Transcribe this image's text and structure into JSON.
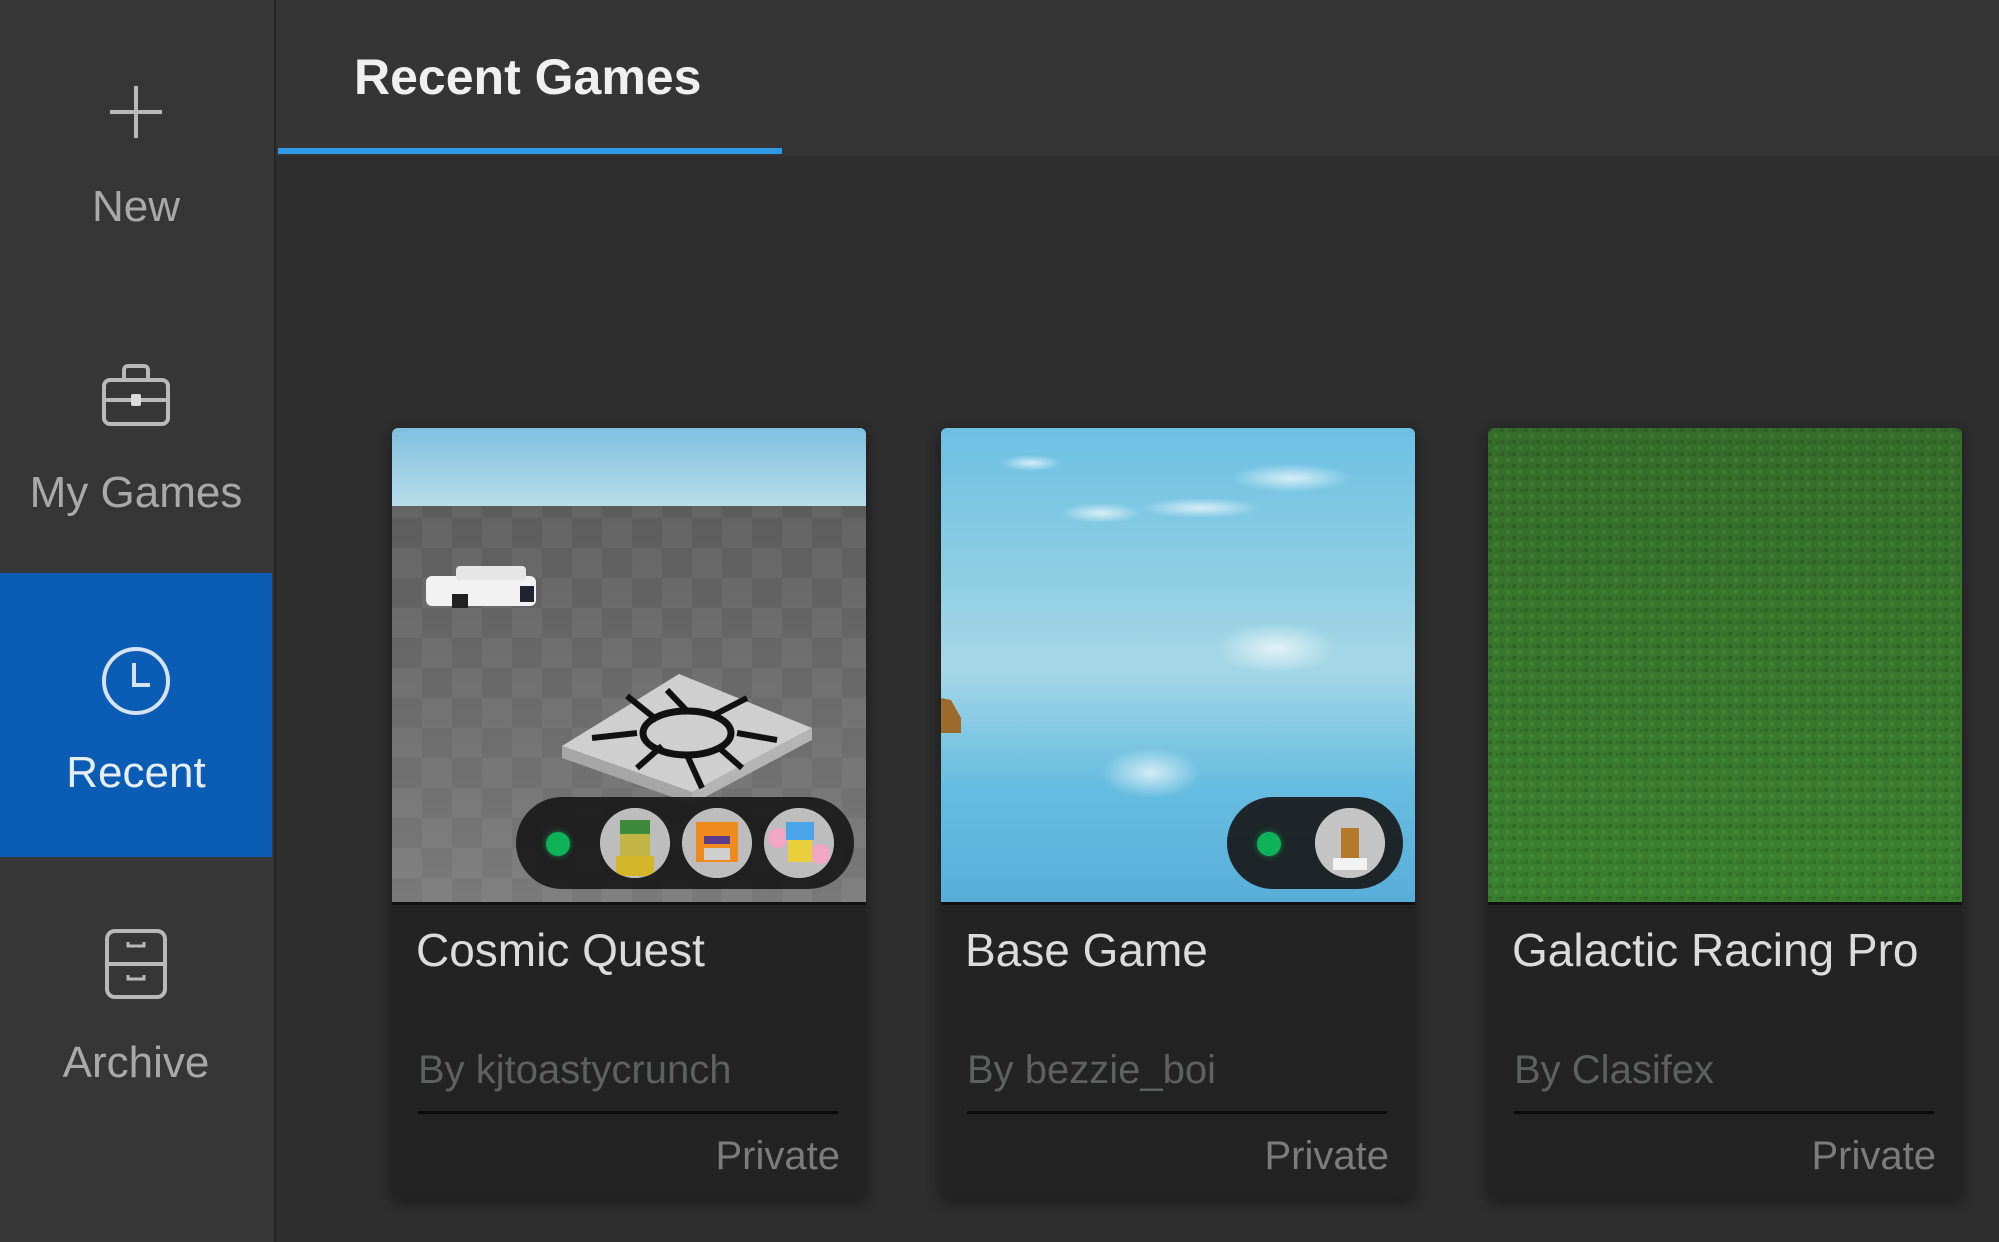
{
  "sidebar": {
    "items": [
      {
        "label": "New",
        "icon": "plus-icon",
        "active": false
      },
      {
        "label": "My Games",
        "icon": "briefcase-icon",
        "active": false
      },
      {
        "label": "Recent",
        "icon": "clock-icon",
        "active": true
      },
      {
        "label": "Archive",
        "icon": "archive-icon",
        "active": false
      }
    ]
  },
  "header": {
    "tabs": [
      {
        "label": "Recent Games",
        "active": true
      }
    ]
  },
  "colors": {
    "accent": "#2f9ae3",
    "active_sidebar": "#0b5cb5",
    "online": "#0fb257"
  },
  "games": [
    {
      "title": "Cosmic Quest",
      "author": "By kjtoastycrunch",
      "privacy": "Private",
      "thumbnail": "baseplate with car and spawn",
      "online_friends": 3
    },
    {
      "title": "Base Game",
      "author": "By bezzie_boi",
      "privacy": "Private",
      "thumbnail": "sky",
      "online_friends": 1
    },
    {
      "title": "Galactic Racing Pro",
      "author": "By Clasifex",
      "privacy": "Private",
      "thumbnail": "grass",
      "online_friends": 0
    }
  ]
}
